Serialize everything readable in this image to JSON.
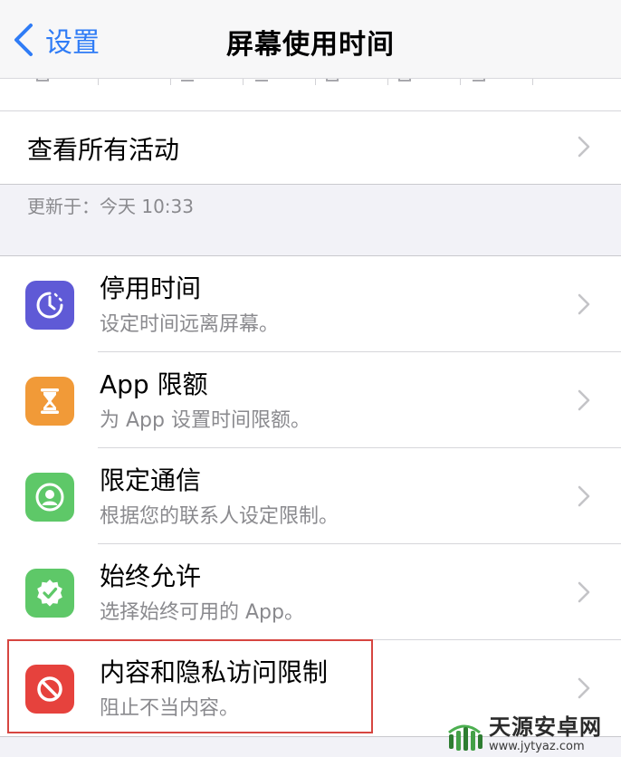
{
  "nav": {
    "back_label": "设置",
    "title": "屏幕使用时间"
  },
  "see_all": {
    "label": "查看所有活动"
  },
  "updated": "更新于：今天 10:33",
  "rows": [
    {
      "title": "停用时间",
      "subtitle": "设定时间远离屏幕。",
      "icon": "downtime-icon",
      "color": "#5f5ad6"
    },
    {
      "title": "App 限额",
      "subtitle": "为 App 设置时间限额。",
      "icon": "hourglass-icon",
      "color": "#f19a38"
    },
    {
      "title": "限定通信",
      "subtitle": "根据您的联系人设定限制。",
      "icon": "contact-icon",
      "color": "#5ec868"
    },
    {
      "title": "始终允许",
      "subtitle": "选择始终可用的 App。",
      "icon": "checkmark-badge-icon",
      "color": "#5ec868"
    },
    {
      "title": "内容和隐私访问限制",
      "subtitle": "阻止不当内容。",
      "icon": "restriction-icon",
      "color": "#e6423d"
    }
  ],
  "watermark": {
    "name": "天源安卓网",
    "url": "www.jytyaz.com"
  },
  "colors": {
    "accent": "#2f7cf6",
    "highlight": "#d64540"
  }
}
